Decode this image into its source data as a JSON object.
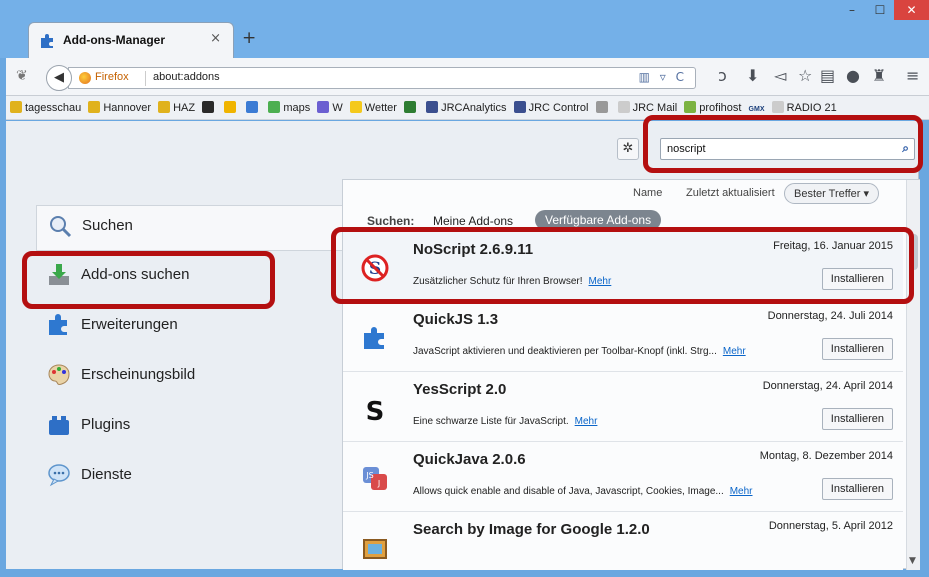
{
  "window": {
    "tab_title": "Add-ons-Manager",
    "tab_close": "×",
    "new_tab": "+",
    "min": "–",
    "max": "☐",
    "close": "✕"
  },
  "navbar": {
    "identity_label": "Firefox",
    "url": "about:addons",
    "url_tools": "▥ ▿ C"
  },
  "bookmarks": [
    {
      "label": "tagesschau",
      "color": "#e0b21d"
    },
    {
      "label": "Hannover",
      "color": "#e0b21d"
    },
    {
      "label": "HAZ",
      "color": "#e0b21d"
    },
    {
      "label": "",
      "color": "#2a2a2a"
    },
    {
      "label": "",
      "color": "#f0b400"
    },
    {
      "label": "",
      "color": "#3b7bd4"
    },
    {
      "label": "maps",
      "color": "#4caf50"
    },
    {
      "label": "W",
      "color": "#6b5fd1"
    },
    {
      "label": "Wetter",
      "color": "#f4c91c"
    },
    {
      "label": "",
      "color": "#2e7d32"
    },
    {
      "label": "JRCAnalytics",
      "color": "#3b4f8f"
    },
    {
      "label": "JRC Control",
      "color": "#3b4f8f"
    },
    {
      "label": "",
      "color": "#999999"
    },
    {
      "label": "JRC Mail",
      "color": "#cccccc"
    },
    {
      "label": "profihost",
      "color": "#7cb342"
    },
    {
      "label": "GMX",
      "color": "#1a3e7a"
    },
    {
      "label": "RADIO 21",
      "color": "#cccccc"
    }
  ],
  "search": {
    "value": "noscript"
  },
  "categories": [
    {
      "label": "Suchen"
    },
    {
      "label": "Add-ons suchen"
    },
    {
      "label": "Erweiterungen"
    },
    {
      "label": "Erscheinungsbild"
    },
    {
      "label": "Plugins"
    },
    {
      "label": "Dienste"
    }
  ],
  "sort": {
    "name": "Name",
    "updated": "Zuletzt aktualisiert",
    "best": "Bester Treffer ▾"
  },
  "filter": {
    "label": "Suchen:",
    "mine": "Meine Add-ons",
    "available": "Verfügbare Add-ons"
  },
  "results": [
    {
      "name": "NoScript  2.6.9.11",
      "date": "Freitag, 16. Januar 2015",
      "desc": "Zusätzlicher Schutz für Ihren Browser!",
      "more": "Mehr",
      "install": "Installieren"
    },
    {
      "name": "QuickJS  1.3",
      "date": "Donnerstag, 24. Juli 2014",
      "desc": "JavaScript aktivieren und deaktivieren per Toolbar-Knopf (inkl. Strg...",
      "more": "Mehr",
      "install": "Installieren"
    },
    {
      "name": "YesScript  2.0",
      "date": "Donnerstag, 24. April 2014",
      "desc": "Eine schwarze Liste für JavaScript.",
      "more": "Mehr",
      "install": "Installieren"
    },
    {
      "name": "QuickJava  2.0.6",
      "date": "Montag, 8. Dezember 2014",
      "desc": "Allows quick enable and disable of Java, Javascript, Cookies, Image...",
      "more": "Mehr",
      "install": "Installieren"
    },
    {
      "name": "Search by Image for Google  1.2.0",
      "date": "Donnerstag, 5. April 2012",
      "desc": "",
      "more": "",
      "install": ""
    }
  ],
  "colors": {
    "highlight": "#b40f10",
    "link": "#0a65c9",
    "titlebar": "#74b0e8"
  }
}
